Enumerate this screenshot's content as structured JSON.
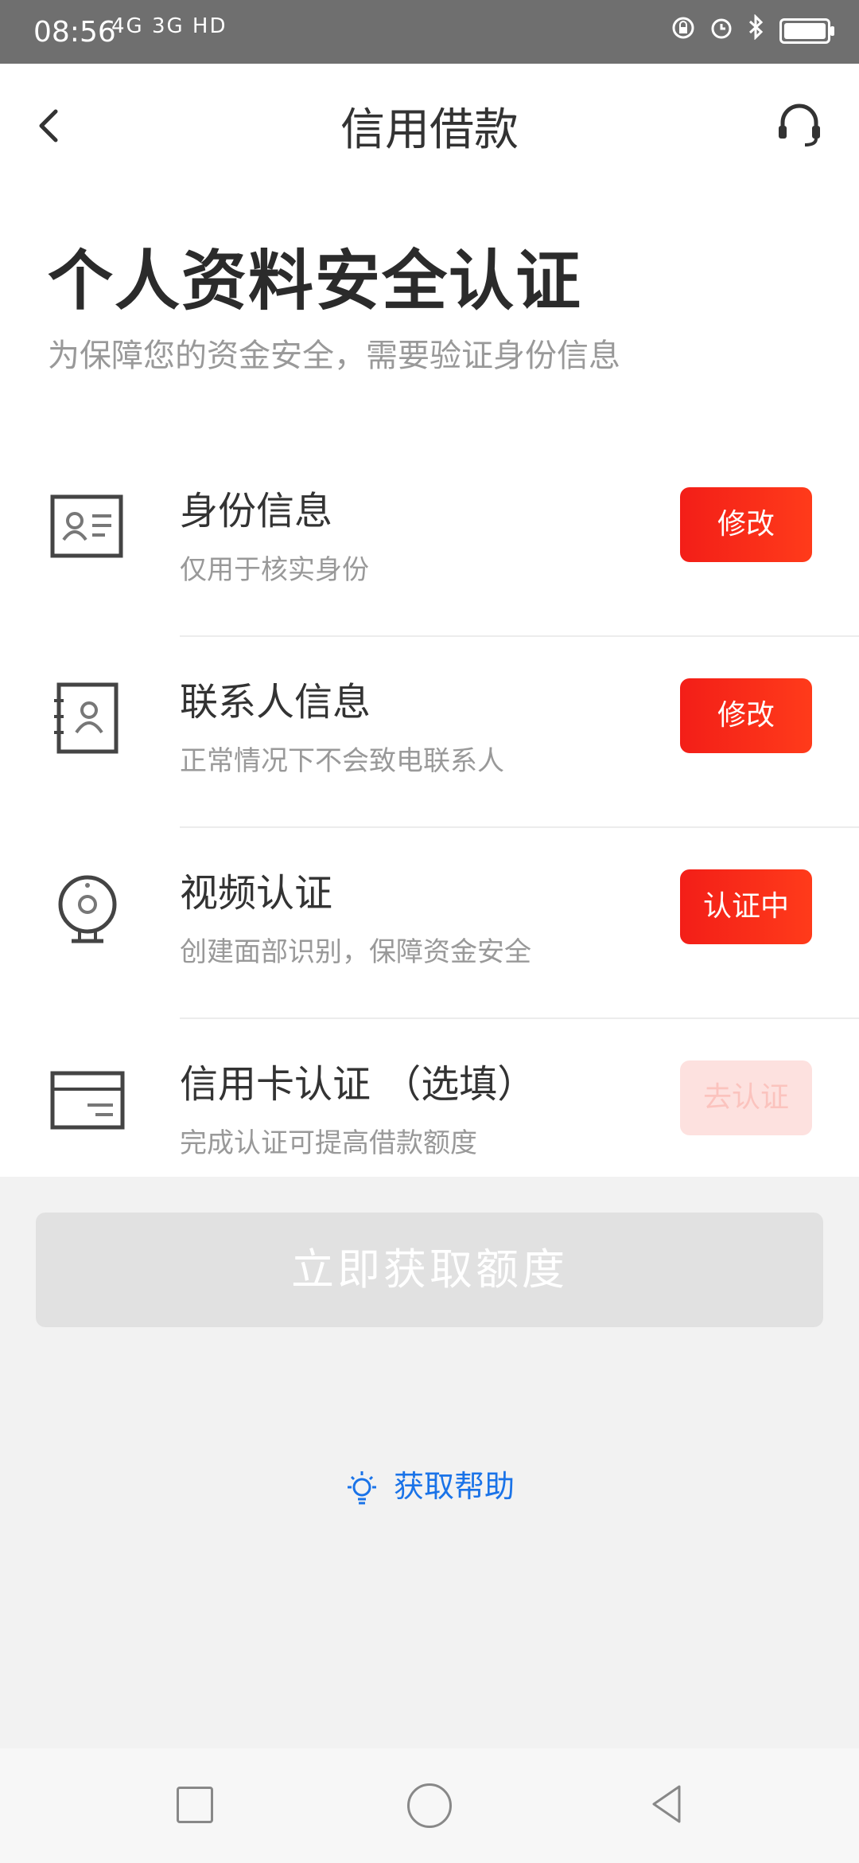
{
  "status_bar": {
    "time": "08:56",
    "network": "4G 3G HD"
  },
  "header": {
    "title": "信用借款"
  },
  "page": {
    "title": "个人资料安全认证",
    "subtitle": "为保障您的资金安全，需要验证身份信息"
  },
  "items": [
    {
      "label": "身份信息",
      "desc": "仅用于核实身份",
      "button": "修改",
      "icon": "id-card-icon"
    },
    {
      "label": "联系人信息",
      "desc": "正常情况下不会致电联系人",
      "button": "修改",
      "icon": "contact-book-icon"
    },
    {
      "label": "视频认证",
      "desc": "创建面部识别，保障资金安全",
      "button": "认证中",
      "icon": "webcam-icon"
    },
    {
      "label": "信用卡认证  （选填）",
      "desc": "完成认证可提高借款额度",
      "button": "去认证",
      "icon": "credit-card-icon"
    }
  ],
  "main_button": "立即获取额度",
  "help_link": "获取帮助",
  "colors": {
    "accent": "#f31e18",
    "accent_faded": "#fde1df",
    "link": "#1a73e8"
  }
}
